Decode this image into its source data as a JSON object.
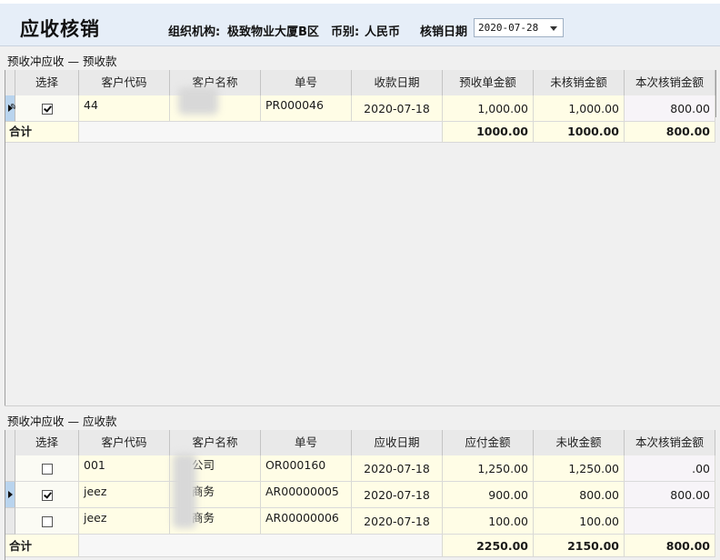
{
  "page": {
    "title": "应收核销",
    "org_label": "组织机构:",
    "org_value": "极致物业大厦B区",
    "currency_label": "币别:",
    "currency_value": "人民币",
    "date_label": "核销日期",
    "date_value": "2020-07-28"
  },
  "top_section": {
    "label": "预收冲应收 — 预收款",
    "columns": [
      "选择",
      "客户代码",
      "客户名称",
      "单号",
      "收款日期",
      "预收单金额",
      "未核销金额",
      "本次核销金额"
    ],
    "rows": [
      {
        "checked": true,
        "code": "44",
        "name": "",
        "doc": "PR000046",
        "date": "2020-07-18",
        "amount": "1,000.00",
        "remaining": "1,000.00",
        "current": "800.00"
      }
    ],
    "total": {
      "label": "合计",
      "amount": "1000.00",
      "remaining": "1000.00",
      "current": "800.00"
    }
  },
  "bottom_section": {
    "label": "预收冲应收 — 应收款",
    "columns": [
      "选择",
      "客户代码",
      "客户名称",
      "单号",
      "应收日期",
      "应付金额",
      "未收金额",
      "本次核销金额"
    ],
    "rows": [
      {
        "checked": false,
        "code": "001",
        "name": "公司",
        "doc": "OR000160",
        "date": "2020-07-18",
        "amount": "1,250.00",
        "remaining": "1,250.00",
        "current": ".00"
      },
      {
        "checked": true,
        "code": "jeez",
        "name": "商务",
        "doc": "AR00000005",
        "date": "2020-07-18",
        "amount": "900.00",
        "remaining": "800.00",
        "current": "800.00"
      },
      {
        "checked": false,
        "code": "jeez",
        "name": "商务",
        "doc": "AR00000006",
        "date": "2020-07-18",
        "amount": "100.00",
        "remaining": "100.00",
        "current": ""
      }
    ],
    "total": {
      "label": "合计",
      "amount": "2250.00",
      "remaining": "2150.00",
      "current": "800.00"
    }
  }
}
